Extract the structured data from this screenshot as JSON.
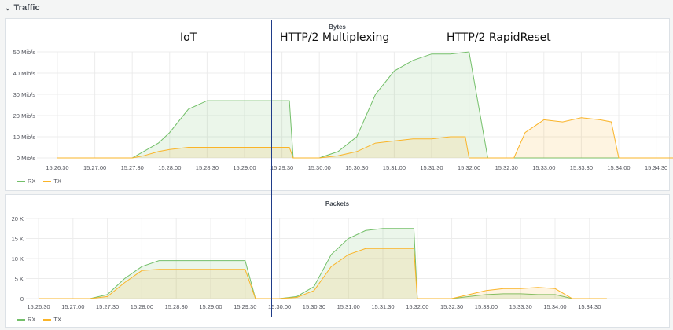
{
  "row": {
    "chevron": "⌄",
    "title": "Traffic"
  },
  "annotations": [
    "IoT",
    "HTTP/2 Multiplexing",
    "HTTP/2 RapidReset"
  ],
  "colors": {
    "rx": "#73bf69",
    "tx": "#fab428",
    "marker": "#1f3c88",
    "grid": "#ececec"
  },
  "chart_data": [
    {
      "type": "area",
      "title": "Bytes",
      "x_ticks": [
        "15:26:30",
        "15:27:00",
        "15:27:30",
        "15:28:00",
        "15:28:30",
        "15:29:00",
        "15:29:30",
        "15:30:00",
        "15:30:30",
        "15:31:00",
        "15:31:30",
        "15:32:00",
        "15:32:30",
        "15:33:00",
        "15:33:30",
        "15:34:00",
        "15:34:30"
      ],
      "y_ticks": [
        "0 Mib/s",
        "10 Mib/s",
        "20 Mib/s",
        "30 Mib/s",
        "40 Mib/s",
        "50 Mib/s"
      ],
      "ylim": [
        0,
        50
      ],
      "legend": [
        "RX",
        "TX"
      ],
      "series": [
        {
          "name": "RX",
          "x": [
            0,
            1,
            1.5,
            2,
            2.3,
            2.7,
            3,
            3.5,
            4,
            4.5,
            5,
            5.5,
            6,
            6.2,
            6.3,
            6.5,
            7,
            7.5,
            8,
            8.5,
            9,
            9.5,
            10,
            10.5,
            11,
            11.5,
            12,
            12.5,
            13,
            13.5,
            14,
            15,
            16,
            16.5
          ],
          "y": [
            0,
            0,
            0,
            0,
            3,
            7,
            12,
            23,
            27,
            27,
            27,
            27,
            27,
            27,
            0,
            0,
            0,
            3,
            10,
            30,
            41,
            46,
            49,
            49,
            50,
            0,
            0,
            0,
            0,
            0,
            0,
            0,
            0,
            0
          ]
        },
        {
          "name": "TX",
          "x": [
            0,
            1,
            1.5,
            2,
            2.3,
            2.7,
            3,
            3.5,
            4,
            5,
            5.5,
            6,
            6.2,
            6.3,
            6.5,
            7,
            7.5,
            8,
            8.5,
            9,
            9.5,
            10,
            10.5,
            10.9,
            11,
            11.5,
            12,
            12.2,
            12.5,
            13,
            13.5,
            14,
            14.5,
            14.8,
            15,
            15.5,
            16,
            16.5
          ],
          "y": [
            0,
            0,
            0,
            0,
            1,
            3,
            4,
            5,
            5,
            5,
            5,
            5,
            5,
            0,
            0,
            0,
            1,
            3,
            7,
            8,
            9,
            9,
            10,
            10,
            0,
            0,
            0,
            0,
            12,
            18,
            17,
            19,
            18,
            17,
            0,
            0,
            0,
            0
          ]
        }
      ]
    },
    {
      "type": "area",
      "title": "Packets",
      "x_ticks": [
        "15:26:30",
        "15:27:00",
        "15:27:30",
        "15:28:00",
        "15:28:30",
        "15:29:00",
        "15:29:30",
        "15:30:00",
        "15:30:30",
        "15:31:00",
        "15:31:30",
        "15:32:00",
        "15:32:30",
        "15:33:00",
        "15:33:30",
        "15:34:00",
        "15:34:30"
      ],
      "y_ticks": [
        "0",
        "5 K",
        "10 K",
        "15 K",
        "20 K"
      ],
      "ylim": [
        0,
        20
      ],
      "legend": [
        "RX",
        "TX"
      ],
      "series": [
        {
          "name": "RX",
          "x": [
            0,
            1,
            1.5,
            2,
            2.5,
            3,
            3.5,
            4,
            4.5,
            5,
            5.5,
            6,
            6.3,
            6.5,
            7,
            7.5,
            8,
            8.5,
            9,
            9.5,
            10,
            10.5,
            10.9,
            11,
            11.5,
            12,
            12.5,
            13,
            13.5,
            14,
            14.5,
            15,
            15.5,
            16,
            16.5
          ],
          "y": [
            0,
            0,
            0,
            1,
            5,
            8,
            9.5,
            9.5,
            9.5,
            9.5,
            9.5,
            9.5,
            0,
            0,
            0,
            0.5,
            3,
            11,
            15,
            17,
            17.5,
            17.5,
            17.5,
            0,
            0,
            0,
            0.5,
            1,
            1.2,
            1.2,
            1,
            1,
            0,
            0,
            0
          ]
        },
        {
          "name": "TX",
          "x": [
            0,
            1,
            1.5,
            2,
            2.5,
            3,
            3.5,
            4,
            4.5,
            5,
            5.5,
            6,
            6.3,
            6.5,
            7,
            7.5,
            8,
            8.5,
            9,
            9.5,
            10,
            10.5,
            10.9,
            11,
            11.5,
            12,
            12.5,
            13,
            13.5,
            14,
            14.5,
            15,
            15.5,
            16,
            16.5
          ],
          "y": [
            0,
            0,
            0,
            0.5,
            4,
            7,
            7.3,
            7.3,
            7.3,
            7.3,
            7.3,
            7.3,
            0,
            0,
            0,
            0.3,
            2,
            8,
            11,
            12.5,
            12.5,
            12.5,
            12.5,
            0,
            0,
            0,
            1,
            2,
            2.5,
            2.5,
            2.8,
            2.5,
            0,
            0,
            0
          ]
        }
      ]
    }
  ]
}
